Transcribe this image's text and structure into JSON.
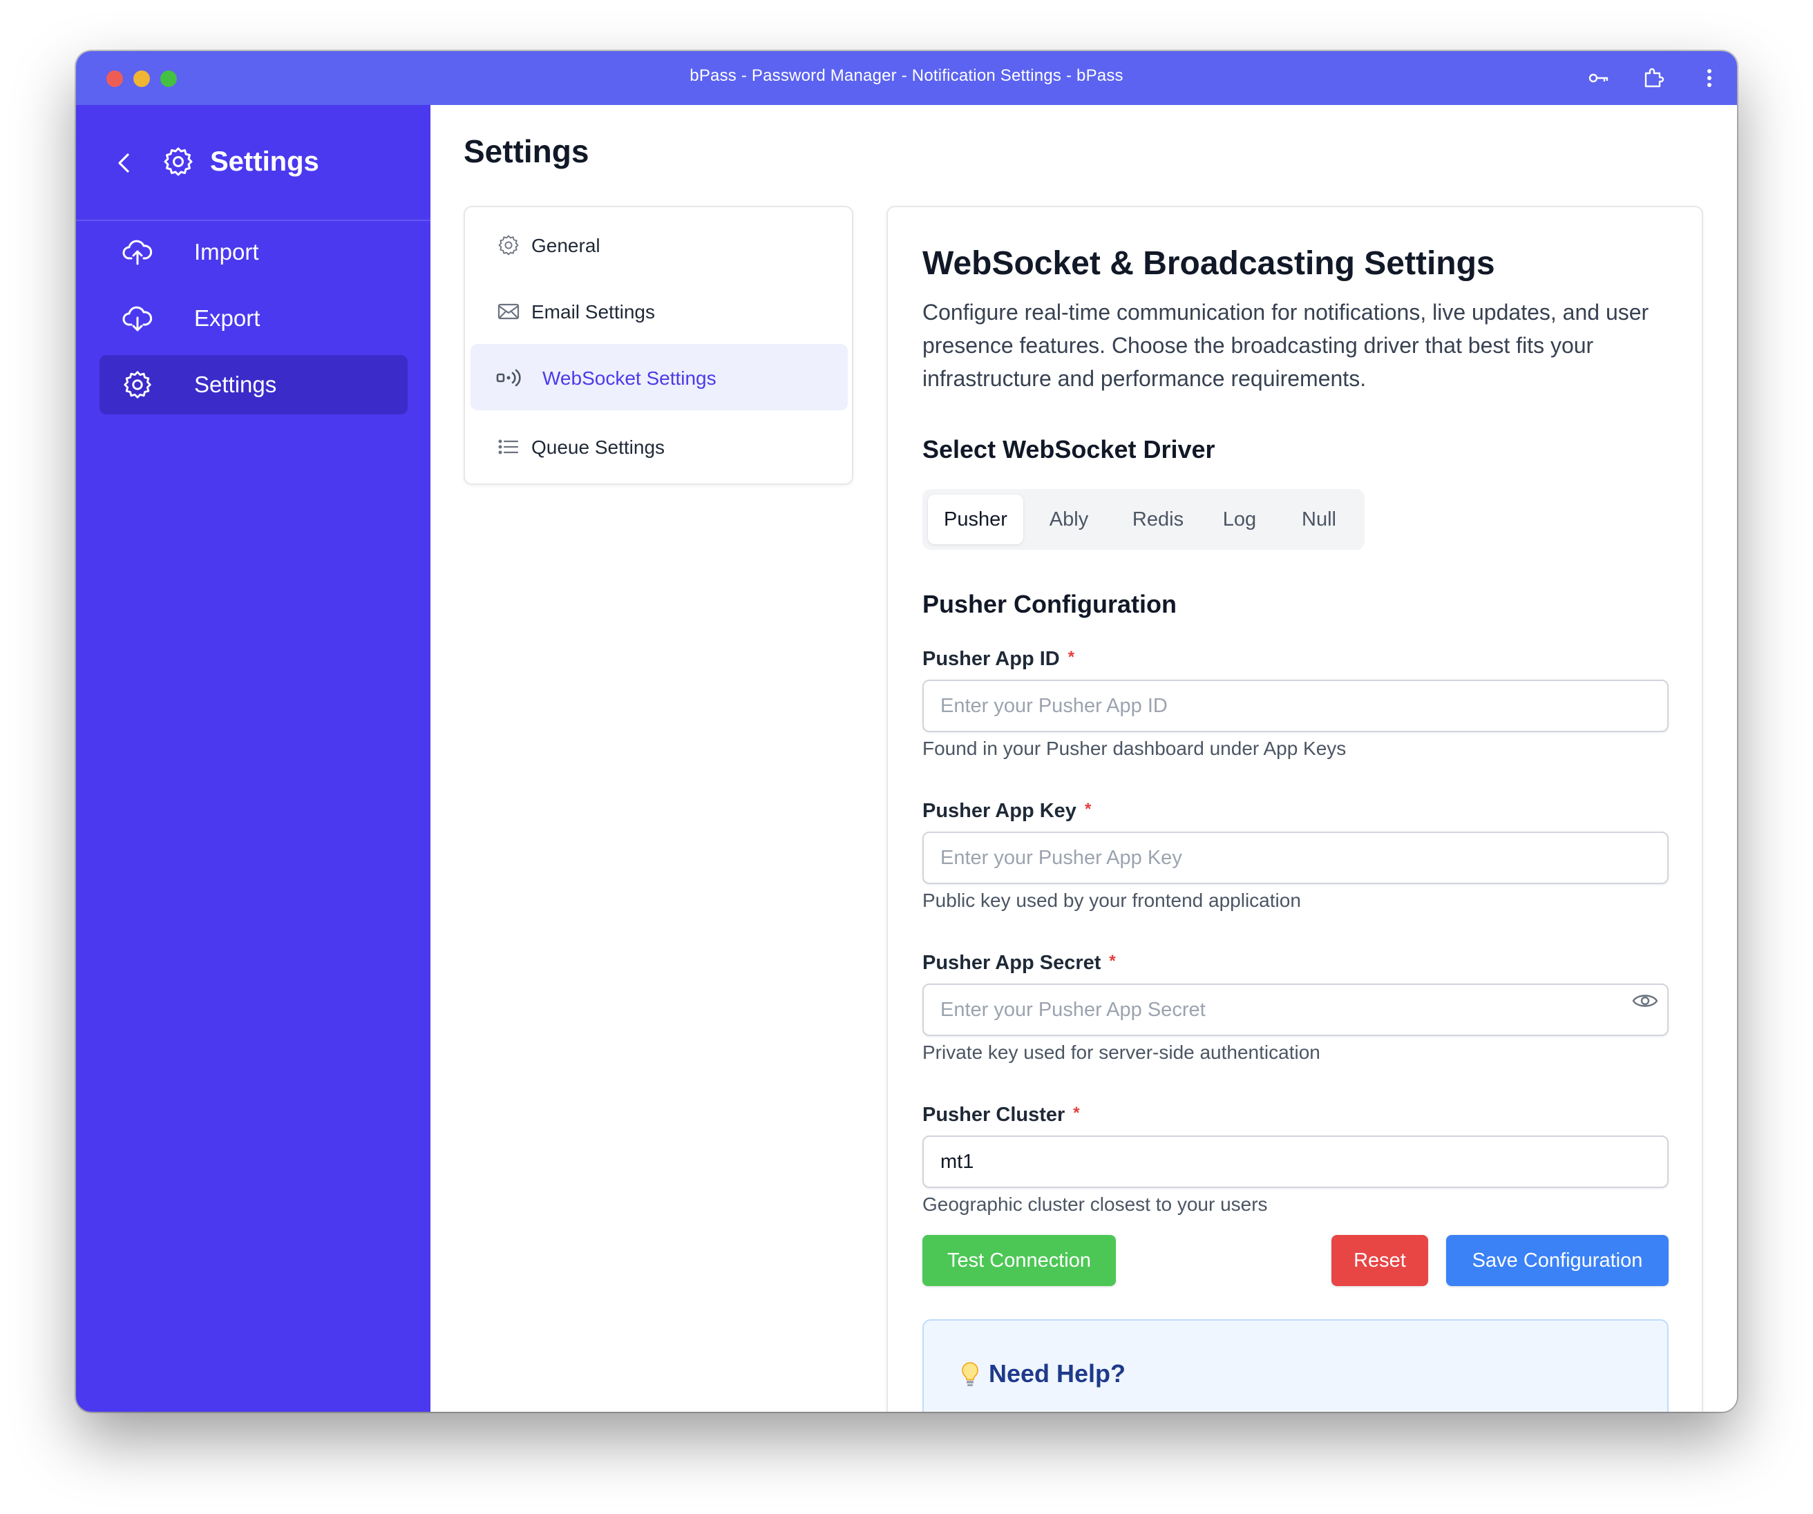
{
  "window": {
    "title": "bPass - Password Manager - Notification Settings - bPass"
  },
  "sidebar": {
    "title": "Settings",
    "items": [
      {
        "label": "Import",
        "icon": "cloud-upload-icon",
        "active": false
      },
      {
        "label": "Export",
        "icon": "cloud-download-icon",
        "active": false
      },
      {
        "label": "Settings",
        "icon": "gear-icon",
        "active": true
      }
    ]
  },
  "main": {
    "page_title": "Settings"
  },
  "subnav": {
    "items": [
      {
        "label": "General",
        "icon": "gear-icon",
        "active": false
      },
      {
        "label": "Email Settings",
        "icon": "envelope-icon",
        "active": false
      },
      {
        "label": "WebSocket Settings",
        "icon": "broadcast-icon",
        "active": true
      },
      {
        "label": "Queue Settings",
        "icon": "list-icon",
        "active": false
      }
    ]
  },
  "card": {
    "title": "WebSocket & Broadcasting Settings",
    "description": "Configure real-time communication for notifications, live updates, and user presence features. Choose the broadcasting driver that best fits your infrastructure and performance requirements.",
    "driver_section_title": "Select WebSocket Driver",
    "drivers": [
      "Pusher",
      "Ably",
      "Redis",
      "Log",
      "Null"
    ],
    "selected_driver": "Pusher",
    "config_title": "Pusher Configuration",
    "required_marker": "*",
    "fields": {
      "app_id": {
        "label": "Pusher App ID",
        "placeholder": "Enter your Pusher App ID",
        "value": "",
        "help": "Found in your Pusher dashboard under App Keys"
      },
      "app_key": {
        "label": "Pusher App Key",
        "placeholder": "Enter your Pusher App Key",
        "value": "",
        "help": "Public key used by your frontend application"
      },
      "app_secret": {
        "label": "Pusher App Secret",
        "placeholder": "Enter your Pusher App Secret",
        "value": "",
        "help": "Private key used for server-side authentication"
      },
      "cluster": {
        "label": "Pusher Cluster",
        "placeholder": "",
        "value": "mt1",
        "help": "Geographic cluster closest to your users"
      }
    },
    "buttons": {
      "test": "Test Connection",
      "reset": "Reset",
      "save": "Save Configuration"
    },
    "help_title": "Need Help?"
  },
  "colors": {
    "titlebar": "#5b63f0",
    "sidebar": "#4b39ef",
    "sidebar_active": "#3b2bc9",
    "accent": "#4a3be8",
    "test_button": "#4cc755",
    "reset_button": "#e84545",
    "save_button": "#3b82f6"
  }
}
